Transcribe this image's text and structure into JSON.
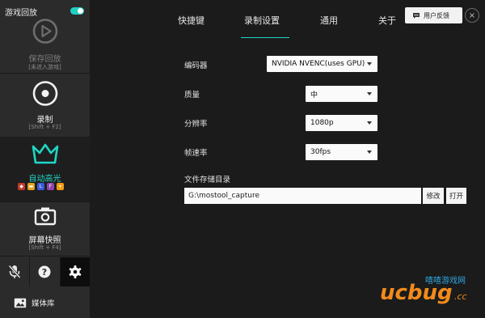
{
  "sidebar": {
    "replay_header": "游戏回放",
    "replay_toggle_on": true,
    "save_replay": {
      "label": "保存回放",
      "sub": "[未进入游戏]"
    },
    "record": {
      "label": "录制",
      "sub": "[Shift + F2]"
    },
    "auto_highlight": {
      "label": "自动高光",
      "app_icons": [
        "dota2",
        "csgo",
        "lol",
        "fortnite",
        "overwatch"
      ]
    },
    "screenshot": {
      "label": "屏幕快照",
      "sub": "[Shift + F4]"
    },
    "bottom_buttons": [
      "mic-off",
      "help",
      "settings"
    ],
    "media_library": "媒体库"
  },
  "header": {
    "tabs": [
      "快捷键",
      "录制设置",
      "通用",
      "关于"
    ],
    "active_tab": "录制设置",
    "feedback_label": "用户反馈",
    "close_label": "×"
  },
  "settings": {
    "encoder": {
      "label": "编码器",
      "value": "NVIDIA NVENC(uses GPU)"
    },
    "quality": {
      "label": "质量",
      "value": "中"
    },
    "resolution": {
      "label": "分辨率",
      "value": "1080p"
    },
    "framerate": {
      "label": "帧速率",
      "value": "30fps"
    },
    "storage": {
      "label": "文件存储目录",
      "path": "G:\\mostool_capture",
      "modify_label": "修改",
      "open_label": "打开"
    }
  },
  "watermark": {
    "text": "ucbug",
    "cc": ".cc",
    "site": "嘻嘻游戏网"
  },
  "colors": {
    "accent": "#20d6c6",
    "sidebar_bg": "#2b2b2b",
    "main_bg": "#1b1b1b"
  }
}
